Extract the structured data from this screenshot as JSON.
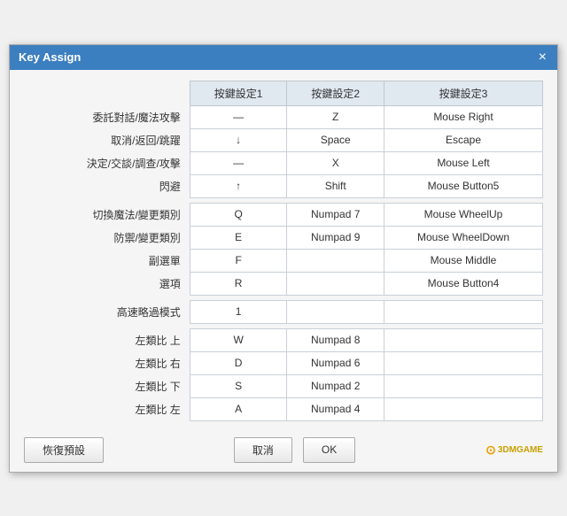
{
  "window": {
    "title": "Key Assign",
    "close_label": "×"
  },
  "table": {
    "headers": [
      "按鍵設定1",
      "按鍵設定2",
      "按鍵設定3"
    ],
    "rows": [
      {
        "label": "委託對話/魔法攻擊",
        "key1": "—",
        "key2": "Z",
        "key3": "Mouse Right"
      },
      {
        "label": "取消/返回/跳躍",
        "key1": "↓",
        "key2": "Space",
        "key3": "Escape"
      },
      {
        "label": "決定/交談/調查/攻擊",
        "key1": "—",
        "key2": "X",
        "key3": "Mouse Left"
      },
      {
        "label": "閃避",
        "key1": "↑",
        "key2": "Shift",
        "key3": "Mouse Button5"
      },
      {
        "label": "SPACER",
        "key1": "",
        "key2": "",
        "key3": ""
      },
      {
        "label": "切換魔法/變更類別",
        "key1": "Q",
        "key2": "Numpad 7",
        "key3": "Mouse WheelUp"
      },
      {
        "label": "防禦/變更類別",
        "key1": "E",
        "key2": "Numpad 9",
        "key3": "Mouse WheelDown"
      },
      {
        "label": "副選單",
        "key1": "F",
        "key2": "",
        "key3": "Mouse Middle"
      },
      {
        "label": "選項",
        "key1": "R",
        "key2": "",
        "key3": "Mouse Button4"
      },
      {
        "label": "SPACER",
        "key1": "",
        "key2": "",
        "key3": ""
      },
      {
        "label": "高速略過模式",
        "key1": "1",
        "key2": "",
        "key3": ""
      },
      {
        "label": "SPACER",
        "key1": "",
        "key2": "",
        "key3": ""
      },
      {
        "label": "左類比 上",
        "key1": "W",
        "key2": "Numpad 8",
        "key3": ""
      },
      {
        "label": "左類比 右",
        "key1": "D",
        "key2": "Numpad 6",
        "key3": ""
      },
      {
        "label": "左類比 下",
        "key1": "S",
        "key2": "Numpad 2",
        "key3": ""
      },
      {
        "label": "左類比 左",
        "key1": "A",
        "key2": "Numpad 4",
        "key3": ""
      }
    ]
  },
  "footer": {
    "reset_label": "恢復預設",
    "cancel_label": "取消",
    "ok_label": "OK",
    "watermark": "3DMGAME"
  }
}
